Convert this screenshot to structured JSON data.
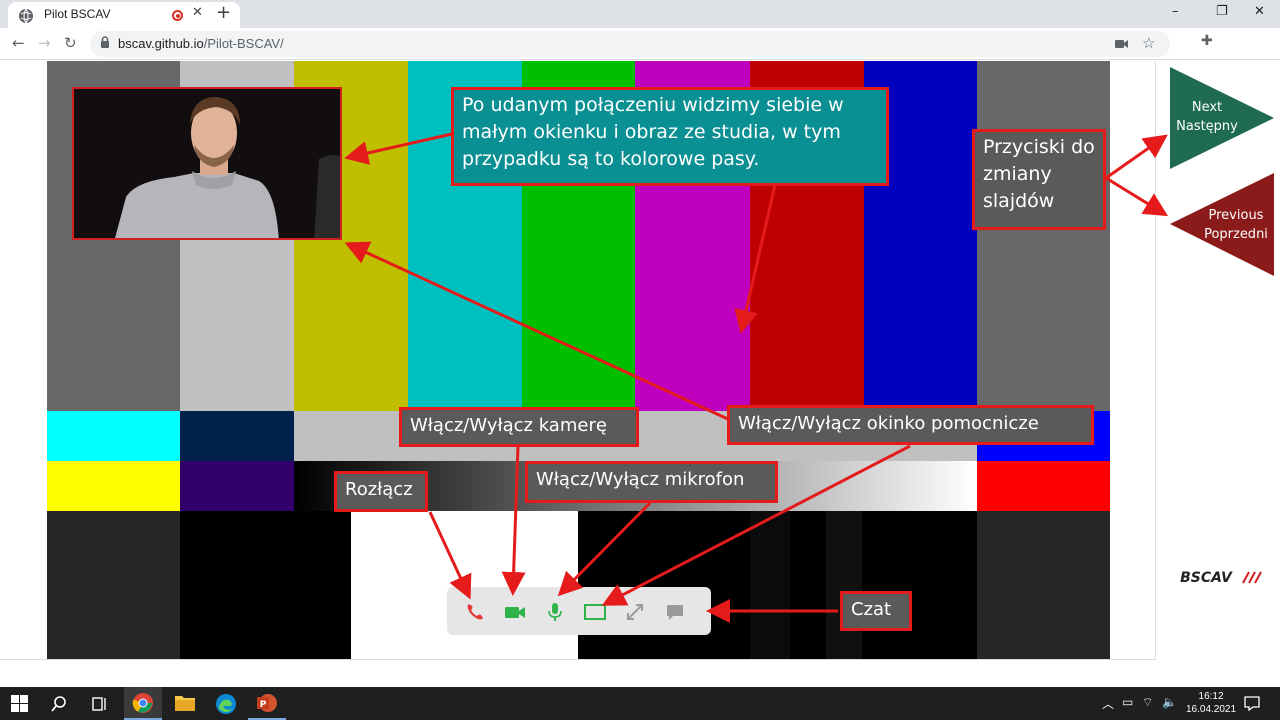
{
  "browser": {
    "tab_title": "Pilot BSCAV",
    "url_domain": "bscav.github.io",
    "url_path": "/Pilot-BSCAV/",
    "profile_initial": "B",
    "minimize": "–",
    "maximize": "❐",
    "close": "✕"
  },
  "slide_nav": {
    "next_en": "Next",
    "next_pl": "Następny",
    "prev_en": "Previous",
    "prev_pl": "Poprzedni",
    "next_color": "#1f6b4f",
    "prev_color": "#8b1a1a"
  },
  "brand": {
    "logo_text": "BSCAV"
  },
  "annotations": {
    "intro": "Po udanym połączeniu widzimy siebie w małym okienku i obraz ze studia, w tym przypadku są to kolorowe pasy.",
    "slides": "Przyciski do zmiany slajdów",
    "camera": "Włącz/Wyłącz kamerę",
    "helper": "Włącz/Wyłącz okinko pomocnicze",
    "mic": "Włącz/Wyłącz mikrofon",
    "hangup": "Rozłącz",
    "chat": "Czat"
  },
  "controls": {
    "hangup_icon": "phone-icon",
    "camera_icon": "video-camera-icon",
    "mic_icon": "microphone-icon",
    "pip_icon": "screen-icon",
    "fullscreen_icon": "expand-icon",
    "chat_icon": "chat-bubble-icon",
    "active_color": "#2fb34a",
    "hangup_color": "#e53935"
  },
  "taskbar": {
    "time": "16:12",
    "date": "16.04.2021"
  }
}
